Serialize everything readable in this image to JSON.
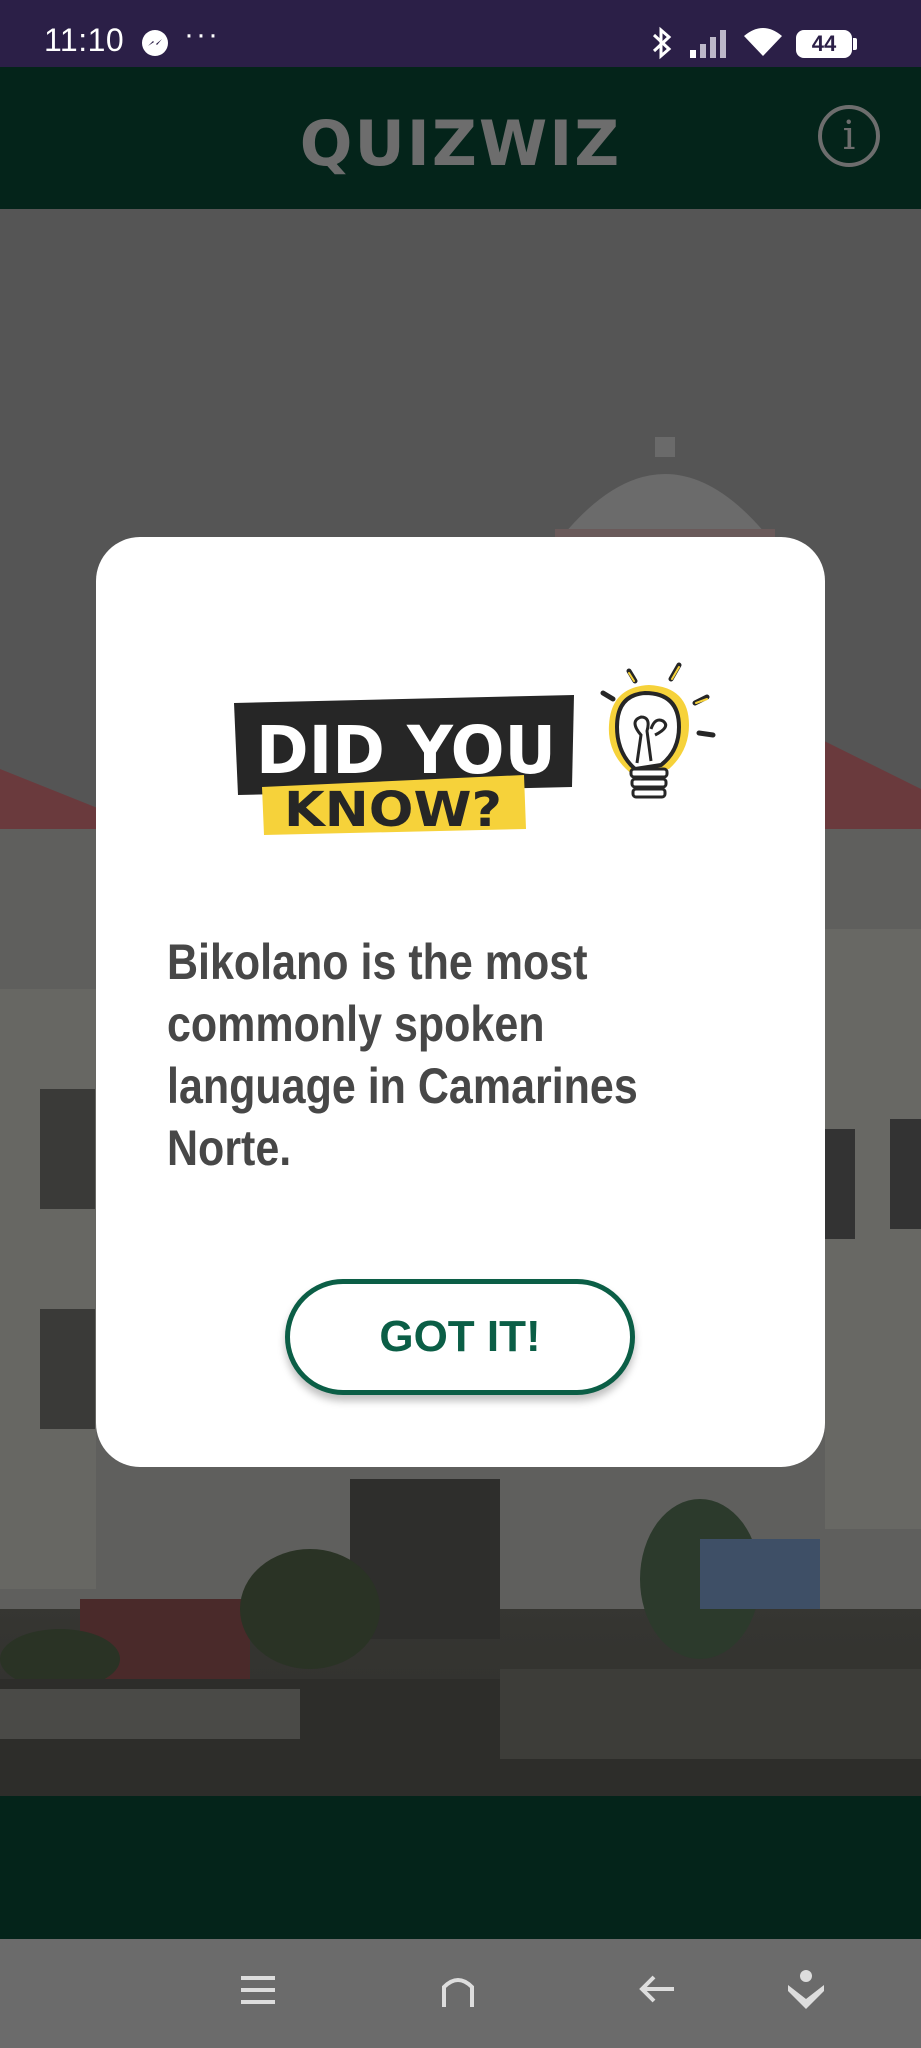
{
  "status_bar": {
    "time": "11:10",
    "more": "···",
    "battery": "44",
    "icons": [
      "messenger-icon",
      "bluetooth-icon",
      "signal-icon",
      "wifi-icon",
      "battery-icon"
    ]
  },
  "header": {
    "title": "QUIZWIZ",
    "info_icon": "i"
  },
  "dialog": {
    "banner_line1": "DID YOU",
    "banner_line2": "KNOW?",
    "fact": "Bikolano is the most commonly spoken language in Camarines Norte.",
    "button_label": "GOT IT!"
  },
  "nav": {
    "icons": [
      "menu-icon",
      "home-icon",
      "back-icon",
      "accessibility-icon"
    ]
  },
  "colors": {
    "status_bar": "#2b1f47",
    "header": "#04241a",
    "accent": "#0b5e46",
    "banner_yellow": "#f6d23a",
    "banner_dark": "#262626"
  }
}
